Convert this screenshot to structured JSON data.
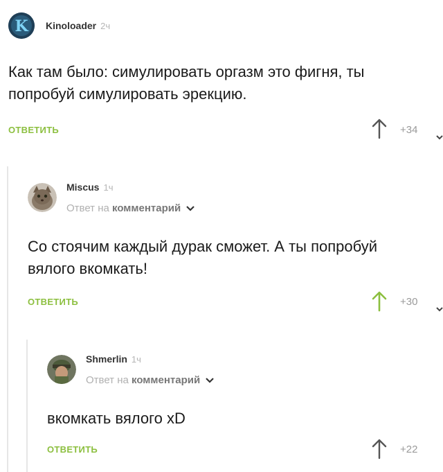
{
  "comments": [
    {
      "author": "Kinoloader",
      "time": "2ч",
      "reply_prefix": "",
      "reply_target": "",
      "text_lines": [
        "Как там было: симулировать оргазм это фигня, ты",
        "попробуй симулировать эрекцию."
      ],
      "reply_label": "ОТВЕТИТЬ",
      "rating": "+34",
      "vote_state": "neutral"
    },
    {
      "author": "Miscus",
      "time": "1ч",
      "reply_prefix": "Ответ на",
      "reply_target": "комментарий",
      "text_lines": [
        "Со стоячим каждый дурак сможет. А ты попробуй",
        "вялого вкомкать!"
      ],
      "reply_label": "ОТВЕТИТЬ",
      "rating": "+30",
      "vote_state": "upvoted"
    },
    {
      "author": "Shmerlin",
      "time": "1ч",
      "reply_prefix": "Ответ на",
      "reply_target": "комментарий",
      "text_lines": [
        "вкомкать вялого xD"
      ],
      "reply_label": "ОТВЕТИТЬ",
      "rating": "+22",
      "vote_state": "neutral"
    }
  ],
  "colors": {
    "reply_green": "#8cbf3f",
    "upvoted_arrow": "#8cbf3f",
    "neutral_arrow": "#555555"
  }
}
